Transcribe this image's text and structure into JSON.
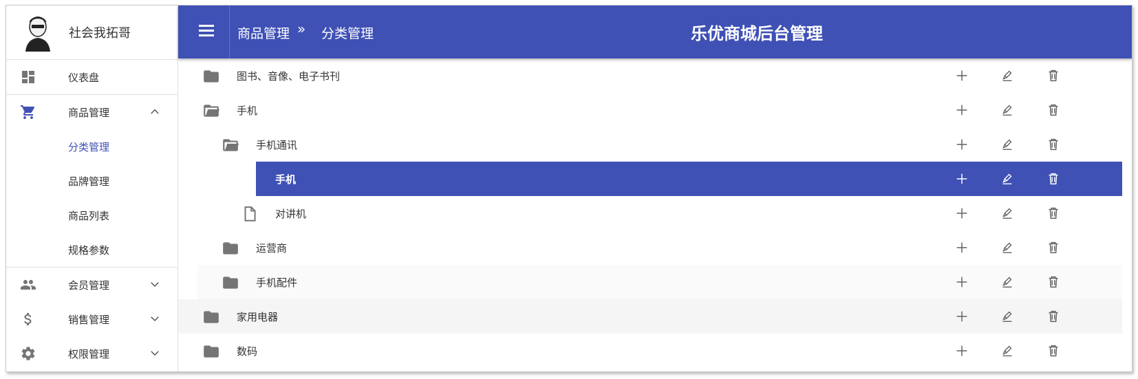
{
  "app": {
    "username": "社会我拓哥",
    "title": "乐优商城后台管理"
  },
  "breadcrumb": {
    "parent": "商品管理",
    "separator": "»",
    "current": "分类管理"
  },
  "sidebar": {
    "items": [
      {
        "label": "仪表盘",
        "icon": "dashboard-icon"
      },
      {
        "label": "商品管理",
        "icon": "cart-icon",
        "expanded": true,
        "children": [
          "分类管理",
          "品牌管理",
          "商品列表",
          "规格参数"
        ],
        "active_child": "分类管理"
      },
      {
        "label": "会员管理",
        "icon": "people-icon",
        "expanded": false
      },
      {
        "label": "销售管理",
        "icon": "dollar-icon",
        "expanded": false
      },
      {
        "label": "权限管理",
        "icon": "gear-icon",
        "expanded": false
      }
    ]
  },
  "tree": {
    "rows": [
      {
        "name": "图书、音像、电子书刊",
        "level": 0,
        "type": "folder"
      },
      {
        "name": "手机",
        "level": 0,
        "type": "folder-open"
      },
      {
        "name": "手机通讯",
        "level": 1,
        "type": "folder-open"
      },
      {
        "name": "手机",
        "level": 2,
        "type": "file",
        "selected": true
      },
      {
        "name": "对讲机",
        "level": 2,
        "type": "file"
      },
      {
        "name": "运营商",
        "level": 1,
        "type": "folder"
      },
      {
        "name": "手机配件",
        "level": 1,
        "type": "folder",
        "hover": true
      },
      {
        "name": "家用电器",
        "level": 0,
        "type": "folder",
        "hover": true
      },
      {
        "name": "数码",
        "level": 0,
        "type": "folder"
      }
    ],
    "actions": [
      "add-icon",
      "edit-icon",
      "delete-icon"
    ]
  },
  "colors": {
    "primary": "#3f51b5",
    "icon": "#757575",
    "hover": "#f5f5f5"
  }
}
